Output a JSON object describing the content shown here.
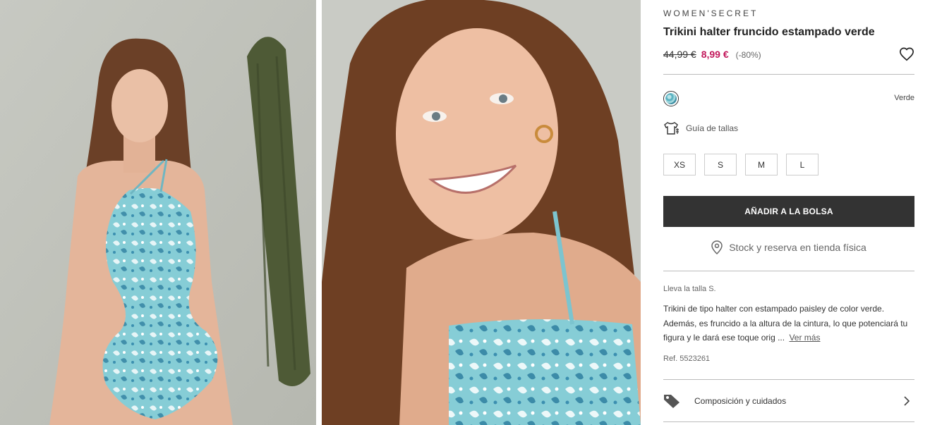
{
  "images": {
    "left": {
      "name": "model-full-body-photo"
    },
    "right": {
      "name": "model-closeup-photo"
    }
  },
  "product": {
    "brand": "WOMEN'SECRET",
    "title": "Trikini halter fruncido estampado verde",
    "price_old": "44,99 €",
    "price_new": "8,99 €",
    "discount": "(-80%)",
    "color_name": "Verde",
    "size_guide": "Guía de tallas",
    "sizes": [
      "XS",
      "S",
      "M",
      "L"
    ],
    "add_to_bag": "AÑADIR A LA BOLSA",
    "store_stock": "Stock y reserva en tienda física",
    "wearing_size": "Lleva la talla S.",
    "description": "Trikini de tipo halter con estampado paisley de color verde. Además, es fruncido a la altura de la cintura, lo que potenciará tu figura y le dará ese toque orig ...",
    "see_more": "Ver más",
    "ref": "Ref. 5523261",
    "composition": "Composición y cuidados"
  },
  "colors": {
    "sale_price": "#c2185b",
    "button_bg": "#333333",
    "swimsuit": "#7cc9d3"
  },
  "icons": [
    "heart-icon",
    "hanger-shirt-icon",
    "location-pin-icon",
    "tag-icon",
    "chevron-right-icon"
  ]
}
